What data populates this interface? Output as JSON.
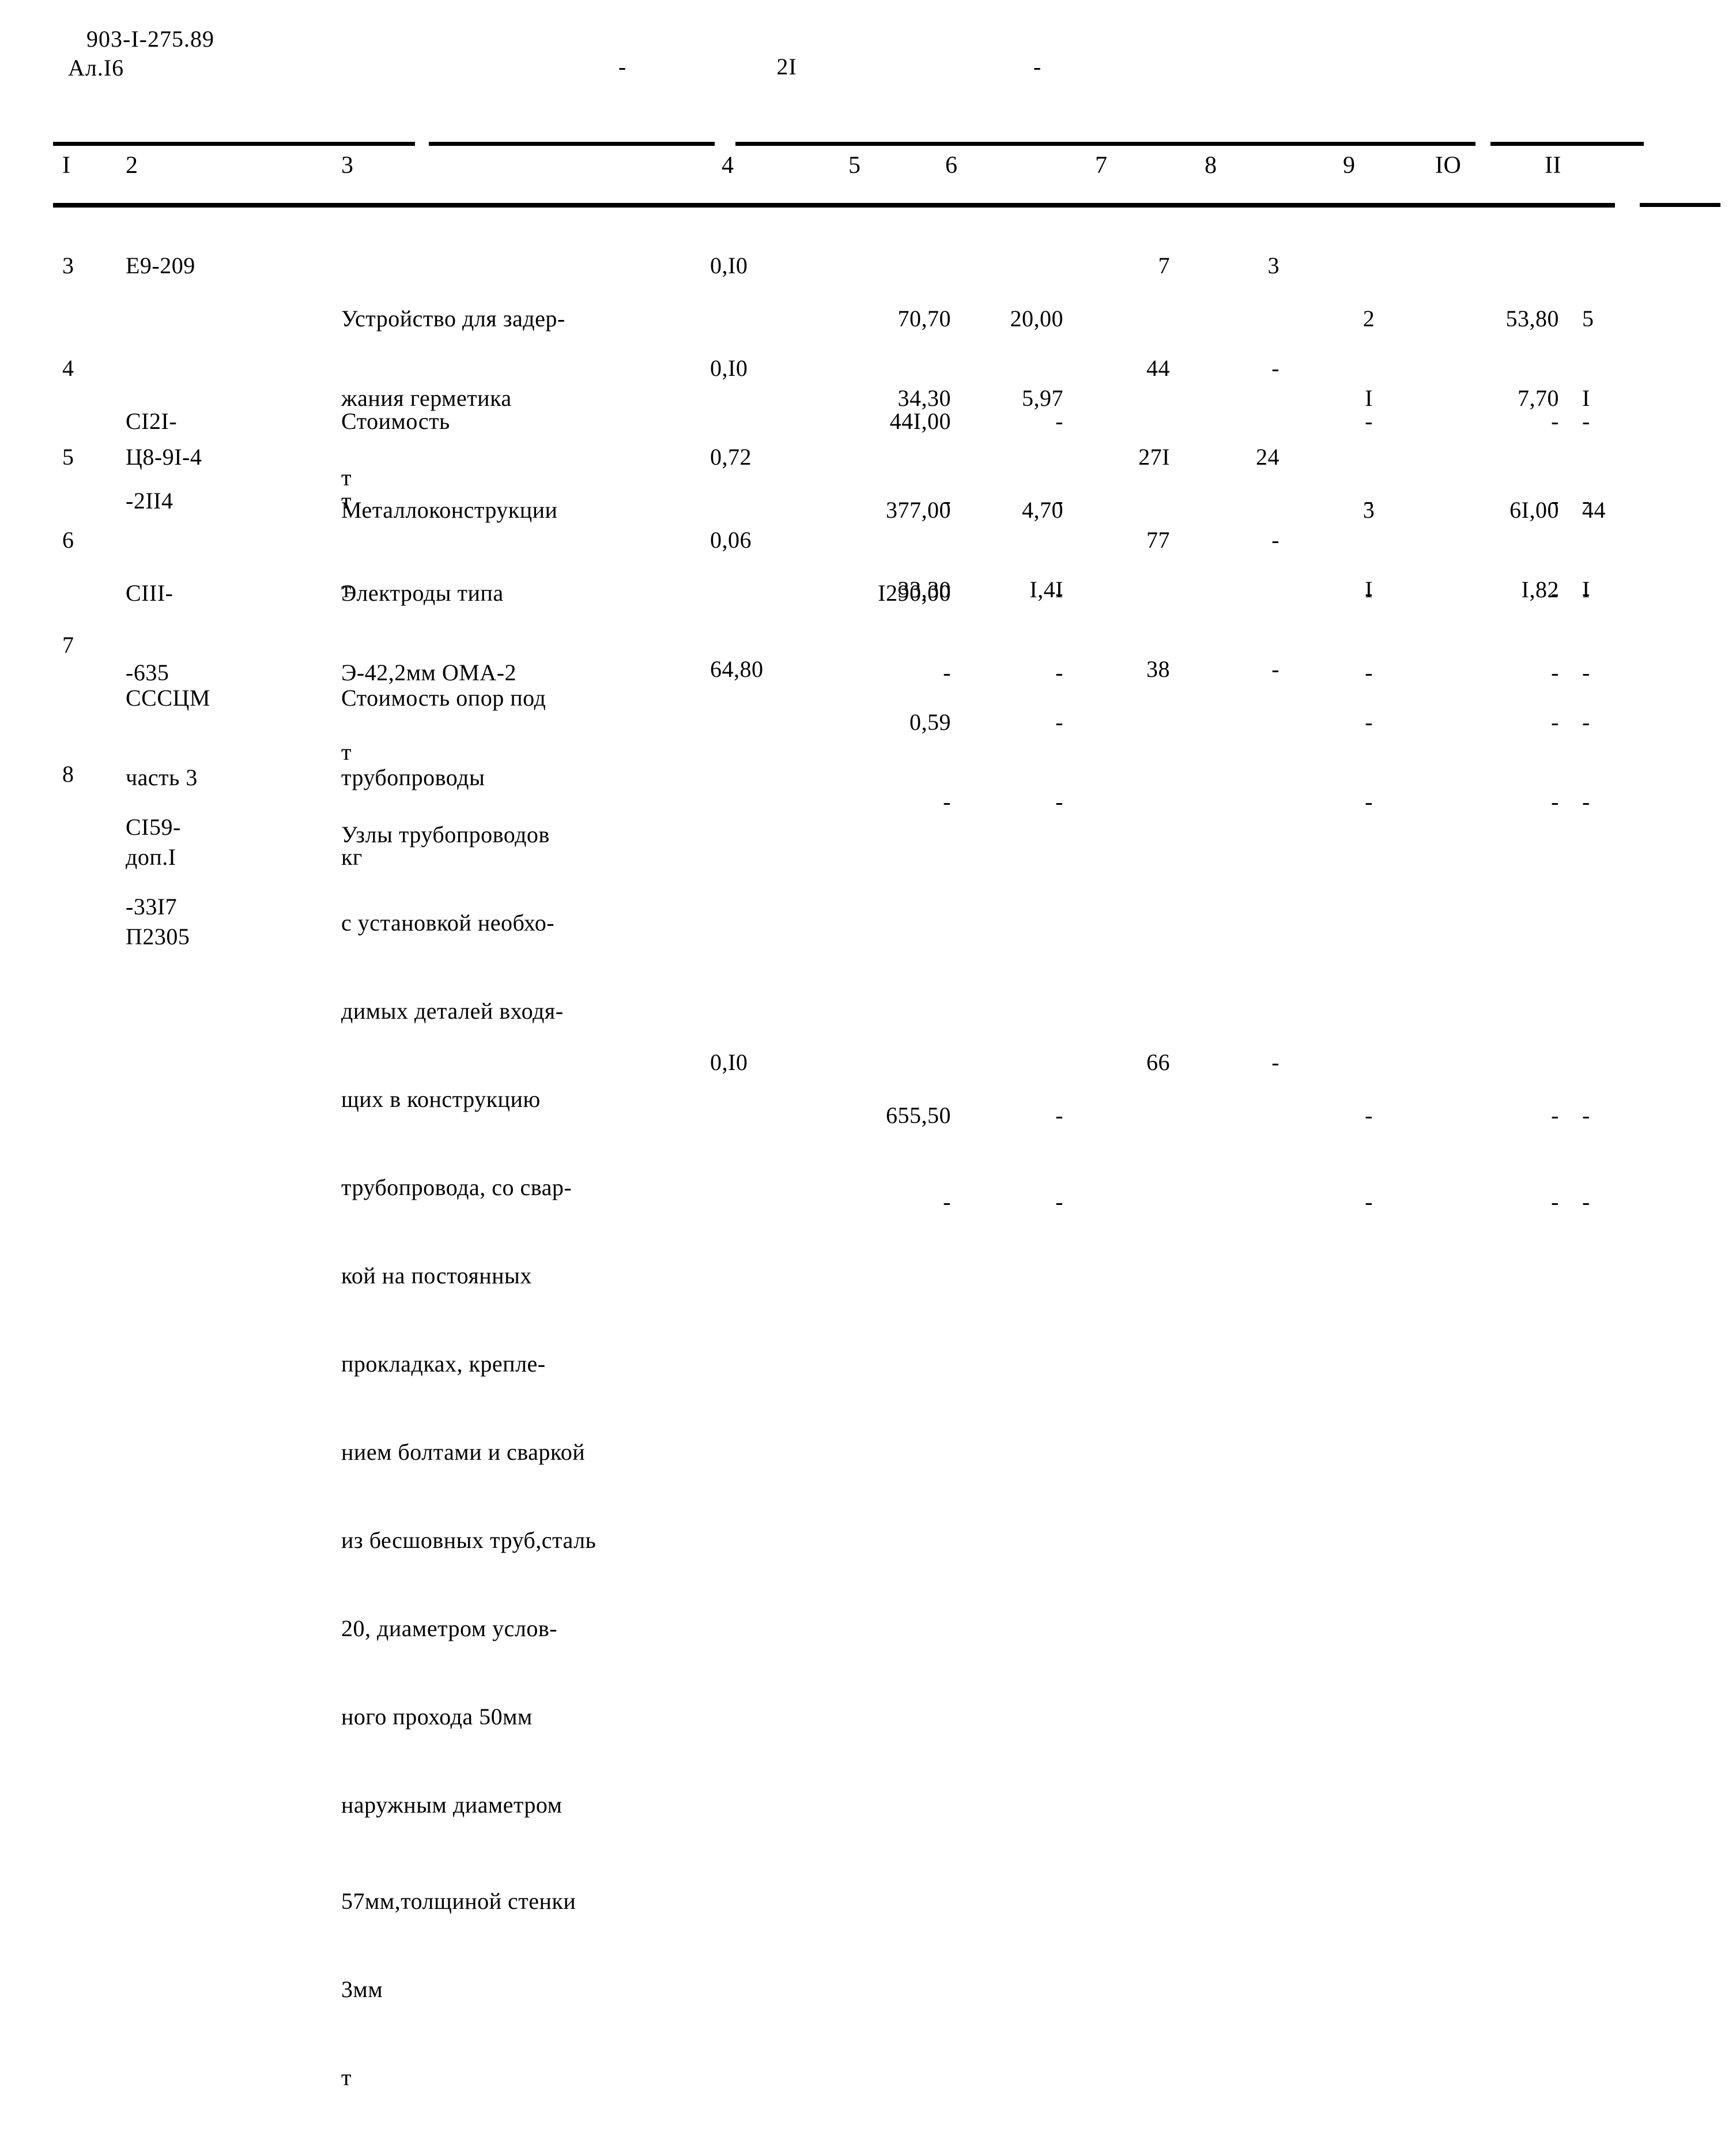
{
  "header": {
    "doc_code": "903-I-275.89",
    "sheet_code": "Ал.I6",
    "page_dash_left": "-",
    "page_number": "2I",
    "page_dash_right": "-"
  },
  "table": {
    "column_headers": [
      "I",
      "2",
      "3",
      "4",
      "5",
      "6",
      "7",
      "8",
      "9",
      "IO",
      "II"
    ],
    "rows": [
      {
        "num": "3",
        "code": "E9-209",
        "description": [
          "Устройство для задер-",
          "жания герметика"
        ],
        "unit": "т",
        "col4": "0,I0",
        "col5_top": "70,70",
        "col5_bot": "34,30",
        "col6_top": "20,00",
        "col6_bot": "5,97",
        "col7_top": "7",
        "col7_bot": "",
        "col8_top": "3",
        "col8_bot": "",
        "col9_top": "2",
        "col9_bot": "I",
        "col10_top": "53,80",
        "col10_bot": "7,70",
        "col11_top": "5",
        "col11_bot": "I"
      },
      {
        "num": "4",
        "code_lines": [
          "CI2I-",
          "-2II4"
        ],
        "description": [
          "Стоимость"
        ],
        "unit": "т",
        "col4": "0,I0",
        "col5_top": "44I,00",
        "col5_bot": "-",
        "col6_top": "-",
        "col6_bot": "-",
        "col7_top": "44",
        "col7_bot": "",
        "col8_top": "-",
        "col8_bot": "",
        "col9_top": "-",
        "col9_bot": "-",
        "col10_top": "-",
        "col10_bot": "-",
        "col11_top": "-",
        "col11_bot": "-"
      },
      {
        "num": "5",
        "code": "Ц8-9I-4",
        "description": [
          "Металлоконструкции"
        ],
        "unit": "т",
        "col4": "0,72",
        "col5_top": "377,00",
        "col5_bot": "33,30",
        "col6_top": "4,70",
        "col6_bot": "I,4I",
        "col7_top": "27I",
        "col7_bot": "",
        "col8_top": "24",
        "col8_bot": "",
        "col9_top": "3",
        "col9_bot": "I",
        "col10_top": "6I,00",
        "col10_bot": "I,82",
        "col11_top": "44",
        "col11_bot": "I"
      },
      {
        "num": "6",
        "code_lines": [
          "CIII-",
          "-635"
        ],
        "description": [
          "Электроды типа",
          "Э-42,2мм ОМА-2"
        ],
        "unit": "т",
        "col4": "0,06",
        "col5_top": "I290,00",
        "col5_bot": "-",
        "col6_top": "-",
        "col6_bot": "-",
        "col7_top": "77",
        "col7_bot": "",
        "col8_top": "-",
        "col8_bot": "",
        "col9_top": "-",
        "col9_bot": "-",
        "col10_top": "-",
        "col10_bot": "-",
        "col11_top": "-",
        "col11_bot": "-"
      },
      {
        "num": "7",
        "code_lines": [
          "СССЦМ",
          "часть 3",
          "доп.I",
          "П2305"
        ],
        "description": [
          "Стоимость опор под",
          "трубопроводы"
        ],
        "unit": "кг",
        "col4": "64,80",
        "col5_top": "0,59",
        "col5_bot": "-",
        "col6_top": "-",
        "col6_bot": "-",
        "col7_top": "38",
        "col7_bot": "",
        "col8_top": "-",
        "col8_bot": "",
        "col9_top": "-",
        "col9_bot": "-",
        "col10_top": "-",
        "col10_bot": "-",
        "col11_top": "-",
        "col11_bot": "-"
      },
      {
        "num": "8",
        "code_lines": [
          "CI59-",
          "-33I7"
        ],
        "description": [
          "Узлы трубопроводов",
          "с установкой необхо-",
          "димых деталей входя-",
          "щих в конструкцию",
          "трубопровода, со свар-",
          "кой на постоянных",
          "прокладках, крепле-",
          "нием болтами и сваркой",
          "из бесшовных труб,сталь",
          "20, диаметром услов-",
          "ного прохода 50мм",
          "наружным диаметром",
          "57мм,толщиной стенки",
          "3мм"
        ],
        "unit": "т",
        "col4": "0,I0",
        "col5_top": "655,50",
        "col5_bot": "-",
        "col6_top": "-",
        "col6_bot": "-",
        "col7_top": "66",
        "col7_bot": "",
        "col8_top": "-",
        "col8_bot": "",
        "col9_top": "-",
        "col9_bot": "-",
        "col10_top": "-",
        "col10_bot": "-",
        "col11_top": "-",
        "col11_bot": "-"
      }
    ]
  }
}
